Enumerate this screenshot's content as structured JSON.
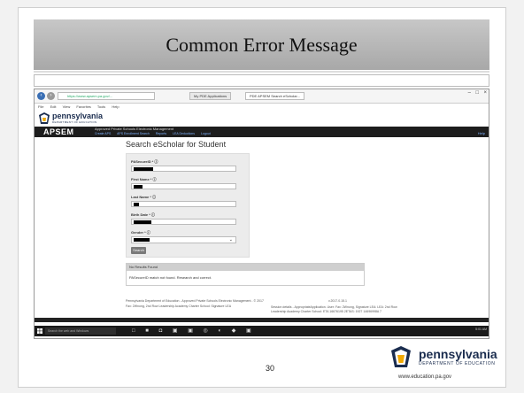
{
  "slide": {
    "title": "Common Error Message",
    "page_number": "30",
    "logo_name": "pennsylvania",
    "logo_dept": "DEPARTMENT OF EDUCATION",
    "logo_url": "www.education.pa.gov"
  },
  "browser": {
    "address": "https://www.apsem.pa.gov/...",
    "tabs": [
      "My PDE Applications",
      "PDE APSEM Search eScholar..."
    ],
    "menu": [
      "File",
      "Edit",
      "View",
      "Favorites",
      "Tools",
      "Help"
    ],
    "window_controls": [
      "–",
      "□",
      "×"
    ]
  },
  "site": {
    "logo_name": "pennsylvania",
    "logo_dept": "DEPARTMENT OF EDUCATION",
    "app_short": "APSEM",
    "app_full": "Approved Private Schools Electronic Management",
    "nav": [
      "Create APS",
      "APS Enrollment Search",
      "Reports",
      "LEA Deductions",
      "Logout"
    ],
    "help": "Help"
  },
  "form": {
    "heading": "Search eScholar for Student",
    "fields": [
      {
        "label": "PASecureID *",
        "kind": "input"
      },
      {
        "label": "First Name *",
        "kind": "input"
      },
      {
        "label": "Last Name *",
        "kind": "input"
      },
      {
        "label": "Birth Date *",
        "kind": "input"
      },
      {
        "label": "Gender *",
        "kind": "select"
      }
    ],
    "search_button": "Search"
  },
  "results": {
    "header": "No Results Found",
    "message": "PASecureID match not found. Research and correct."
  },
  "footer": {
    "line1": "Pennsylvania Department of Education - Approved Private Schools Electronic Management - © 2017",
    "line2": "Fax: 2Wnong, 2nd Row Leadership Academy Charter School: Signature LEA",
    "version": "v.2017.0.15.1",
    "right1": "Session details - AppropriateApplication. User: Fax: 2Wnong, Signature LEA: LEA: 2nd Row",
    "right2": "Leadership Academy Charter School: ETA 16676195 2ETAS: 1927 14696998A 7"
  },
  "taskbar": {
    "search_placeholder": "Search the web and Windows",
    "tray": "5:01 AM"
  }
}
